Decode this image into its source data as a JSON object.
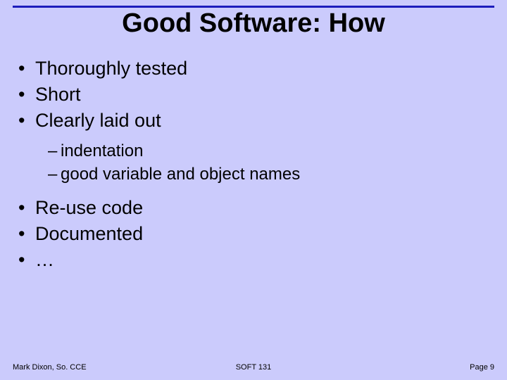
{
  "title": "Good Software: How",
  "bullets": {
    "b0": "Thoroughly tested",
    "b1": "Short",
    "b2": "Clearly laid out",
    "s0": "indentation",
    "s1": "good variable and object names",
    "b3": "Re-use code",
    "b4": "Documented",
    "b5": "…"
  },
  "footer": {
    "left": "Mark Dixon, So. CCE",
    "center": "SOFT 131",
    "right": "Page 9"
  }
}
